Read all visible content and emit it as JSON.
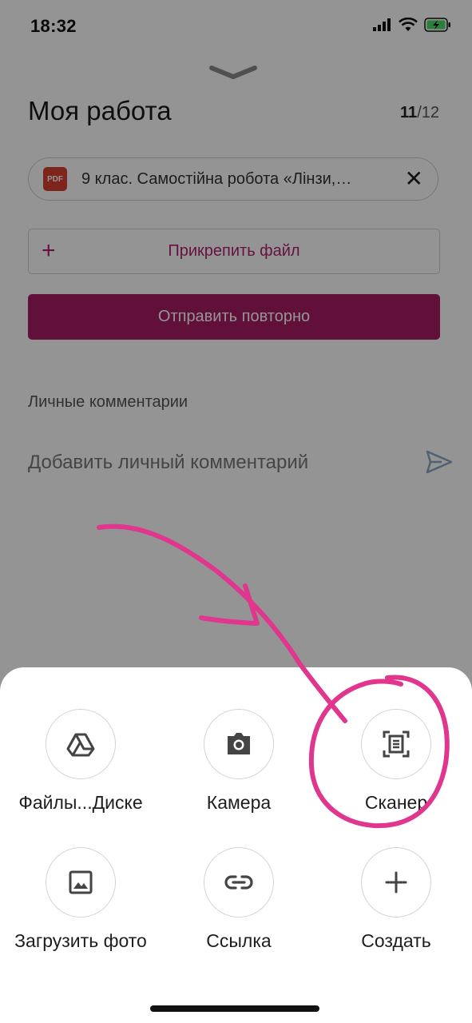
{
  "status_bar": {
    "time": "18:32"
  },
  "page": {
    "title": "Моя работа",
    "counter_current": "11",
    "counter_total": "/12"
  },
  "attachment": {
    "type_badge": "PDF",
    "name": "9 клас. Самостійна робота «Лінзи,…",
    "close_symbol": "✕"
  },
  "actions": {
    "attach_plus": "+",
    "attach_label": "Прикрепить файл",
    "resend_label": "Отправить повторно"
  },
  "comments": {
    "label": "Личные комментарии",
    "placeholder": "Добавить личный комментарий"
  },
  "sheet": {
    "options": [
      {
        "label": "Файлы...Диске",
        "icon": "drive-icon"
      },
      {
        "label": "Камера",
        "icon": "camera-icon"
      },
      {
        "label": "Сканер",
        "icon": "scanner-icon"
      },
      {
        "label": "Загрузить фото",
        "icon": "photo-icon"
      },
      {
        "label": "Ссылка",
        "icon": "link-icon"
      },
      {
        "label": "Создать",
        "icon": "plus-icon"
      }
    ]
  },
  "colors": {
    "accent": "#a81d63",
    "annotation": "#e0368e",
    "pdf_badge": "#d8412f"
  }
}
